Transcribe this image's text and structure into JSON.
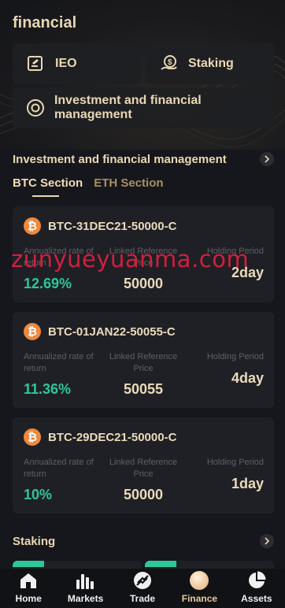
{
  "app": {
    "title": "financial"
  },
  "shortcuts": {
    "ieo": {
      "label": "IEO",
      "icon": "document-edit-icon"
    },
    "staking": {
      "label": "Staking",
      "icon": "hand-coin-icon"
    },
    "investment": {
      "label": "Investment and financial management",
      "icon": "target-icon"
    }
  },
  "investment_section": {
    "title": "Investment and financial management",
    "tabs": [
      {
        "label": "BTC Section",
        "active": true
      },
      {
        "label": "ETH Section",
        "active": false
      }
    ],
    "column_labels": {
      "rate": "Annualized rate of return",
      "reference": "Linked Reference Price",
      "holding": "Holding Period"
    },
    "products": [
      {
        "coin_icon": "bitcoin-icon",
        "name": "BTC-31DEC21-50000-C",
        "rate": "12.69%",
        "reference": "50000",
        "holding": "2day"
      },
      {
        "coin_icon": "bitcoin-icon",
        "name": "BTC-01JAN22-50055-C",
        "rate": "11.36%",
        "reference": "50055",
        "holding": "4day"
      },
      {
        "coin_icon": "bitcoin-icon",
        "name": "BTC-29DEC21-50000-C",
        "rate": "10%",
        "reference": "50000",
        "holding": "1day"
      }
    ]
  },
  "staking_section": {
    "title": "Staking"
  },
  "watermark": "zunyueyuanma.com",
  "bottom_nav": [
    {
      "label": "Home",
      "icon": "home-icon",
      "active": false
    },
    {
      "label": "Markets",
      "icon": "bar-chart-icon",
      "active": false
    },
    {
      "label": "Trade",
      "icon": "trade-icon",
      "active": false
    },
    {
      "label": "Finance",
      "icon": "finance-icon",
      "active": true
    },
    {
      "label": "Assets",
      "icon": "pie-chart-icon",
      "active": false
    }
  ],
  "colors": {
    "accent_gold": "#e8d7b4",
    "positive_green": "#2cc79a",
    "background": "#16171c",
    "card": "#1f2025",
    "bitcoin_orange": "#f0883a"
  }
}
